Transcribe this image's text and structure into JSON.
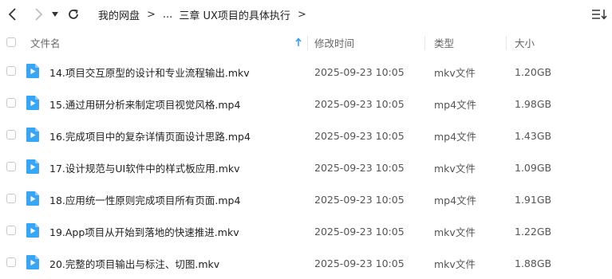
{
  "nav": {
    "breadcrumbs": [
      "我的网盘",
      "...",
      "三章 UX项目的具体执行"
    ]
  },
  "columns": {
    "name": "文件名",
    "modified": "修改时间",
    "type": "类型",
    "size": "大小"
  },
  "sort": {
    "column": "name",
    "direction": "ascending"
  },
  "files": [
    {
      "name": "14.项目交互原型的设计和专业流程输出.mkv",
      "modified": "2025-09-23 10:05",
      "type": "mkv文件",
      "size": "1.20GB"
    },
    {
      "name": "15.通过用研分析来制定项目视觉风格.mp4",
      "modified": "2025-09-23 10:05",
      "type": "mp4文件",
      "size": "1.98GB"
    },
    {
      "name": "16.完成项目中的复杂详情页面设计思路.mp4",
      "modified": "2025-09-23 10:05",
      "type": "mp4文件",
      "size": "1.43GB"
    },
    {
      "name": "17.设计规范与UI软件中的样式板应用.mkv",
      "modified": "2025-09-23 10:05",
      "type": "mkv文件",
      "size": "1.09GB"
    },
    {
      "name": "18.应用统一性原则完成项目所有页面.mp4",
      "modified": "2025-09-23 10:05",
      "type": "mp4文件",
      "size": "1.91GB"
    },
    {
      "name": "19.App项目从开始到落地的快速推进.mkv",
      "modified": "2025-09-23 10:05",
      "type": "mkv文件",
      "size": "1.22GB"
    },
    {
      "name": "20.完整的项目输出与标注、切图.mkv",
      "modified": "2025-09-23 10:05",
      "type": "mkv文件",
      "size": "1.88GB"
    }
  ],
  "colors": {
    "accent": "#2e9cf3",
    "video_icon": "#39a6f5"
  }
}
